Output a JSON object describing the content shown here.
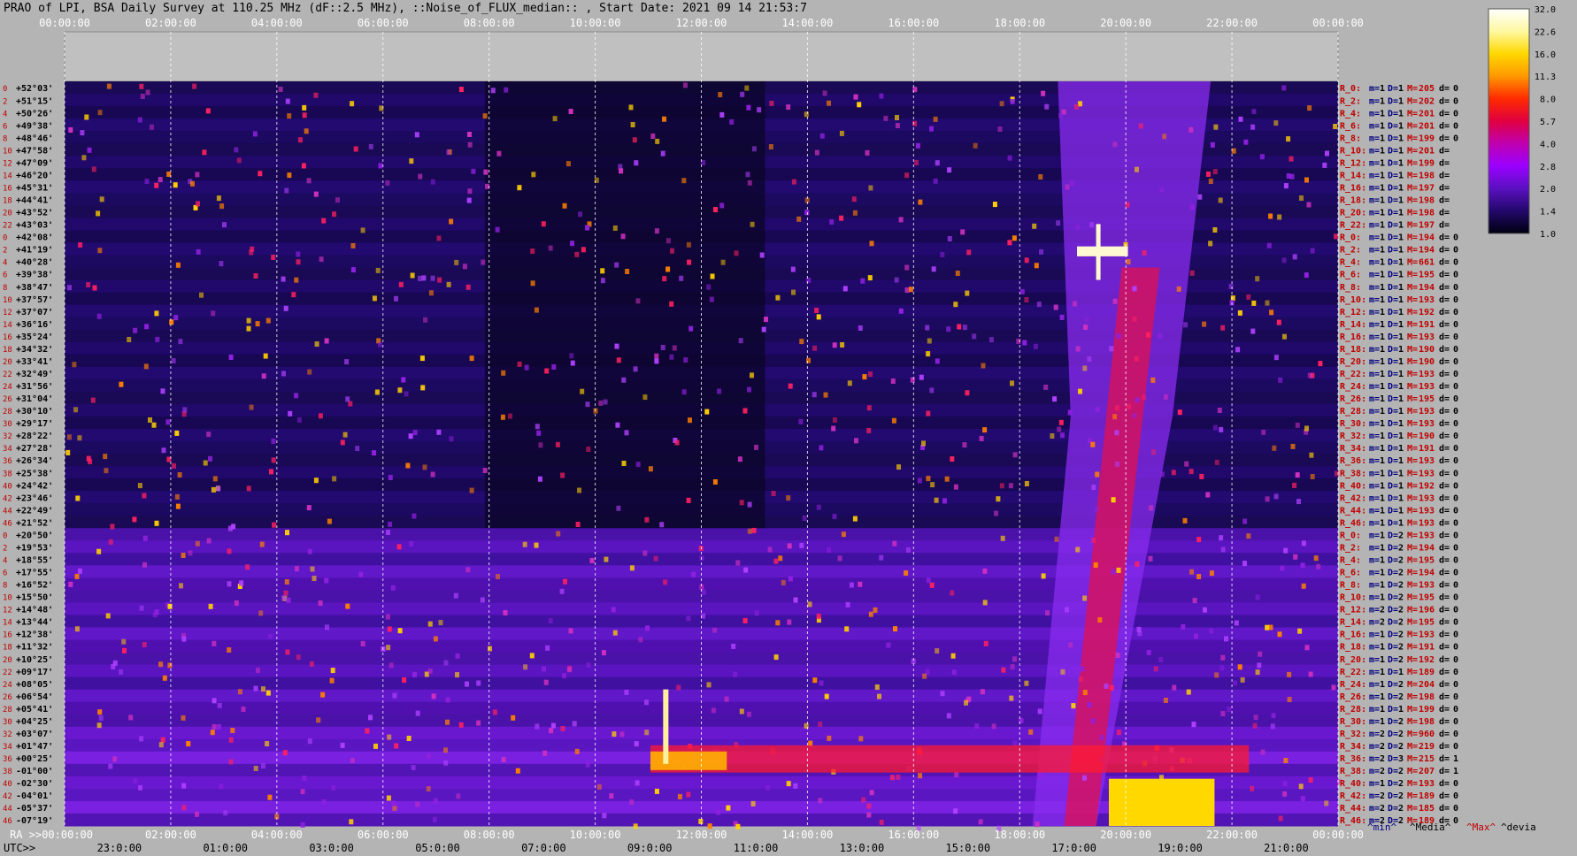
{
  "title": "PRAO of LPI, BSA Daily Survey at 110.25 MHz (dF::2.5 MHz), ::Noise_of_FLUX_median:: , Start Date: 2021 09 14 21:53:7",
  "chart_data": {
    "type": "heatmap",
    "title": "PRAO of LPI, BSA Daily Survey at 110.25 MHz (dF::2.5 MHz), ::Noise_of_FLUX_median:: , Start Date: 2021 09 14 21:53:7",
    "x_top_ticks": [
      "00:00:00",
      "02:00:00",
      "04:00:00",
      "06:00:00",
      "08:00:00",
      "10:00:00",
      "12:00:00",
      "14:00:00",
      "16:00:00",
      "18:00:00",
      "20:00:00",
      "22:00:00",
      "00:00:00"
    ],
    "x_ra_ticks": [
      "RA >>00:00:00",
      "02:00:00",
      "04:00:00",
      "06:00:00",
      "08:00:00",
      "10:00:00",
      "12:00:00",
      "14:00:00",
      "16:00:00",
      "18:00:00",
      "20:00:00",
      "22:00:00",
      "00:00:00"
    ],
    "x_utc_label": "UTC>>",
    "x_utc_ticks": [
      "23:0:00",
      "01:0:00",
      "03:0:00",
      "05:0:00",
      "07:0:00",
      "09:0:00",
      "11:0:00",
      "13:0:00",
      "15:0:00",
      "17:0:00",
      "19:0:00",
      "21:0:00"
    ],
    "dec_labels": [
      "+52°03'",
      "+51°15'",
      "+50°26'",
      "+49°38'",
      "+48°46'",
      "+47°58'",
      "+47°09'",
      "+46°20'",
      "+45°31'",
      "+44°41'",
      "+43°52'",
      "+43°03'",
      "+42°08'",
      "+41°19'",
      "+40°28'",
      "+39°38'",
      "+38°47'",
      "+37°57'",
      "+37°07'",
      "+36°16'",
      "+35°24'",
      "+34°32'",
      "+33°41'",
      "+32°49'",
      "+31°56'",
      "+31°04'",
      "+30°10'",
      "+29°17'",
      "+28°22'",
      "+27°28'",
      "+26°34'",
      "+25°38'",
      "+24°42'",
      "+23°46'",
      "+22°49'",
      "+21°52'",
      "+20°50'",
      "+19°53'",
      "+18°55'",
      "+17°55'",
      "+16°52'",
      "+15°50'",
      "+14°48'",
      "+13°44'",
      "+12°38'",
      "+11°32'",
      "+10°25'",
      "+09°17'",
      "+08°05'",
      "+06°54'",
      "+05°41'",
      "+04°25'",
      "+03°07'",
      "+01°47'",
      "+00°25'",
      "-01°00'",
      "-02°30'",
      "-04°01'",
      "-05°37'",
      "-07°19'"
    ],
    "dec_numbers": [
      "0",
      "2",
      "4",
      "6",
      "8",
      "10",
      "12",
      "14",
      "16",
      "18",
      "20",
      "22",
      "0",
      "2",
      "4",
      "6",
      "8",
      "10",
      "12",
      "14",
      "16",
      "18",
      "20",
      "22",
      "24",
      "26",
      "28",
      "30",
      "32",
      "34",
      "36",
      "38",
      "40",
      "42",
      "44",
      "46",
      "0",
      "2",
      "4",
      "6",
      "8",
      "10",
      "12",
      "14",
      "16",
      "18",
      "20",
      "22",
      "24",
      "26",
      "28",
      "30",
      "32",
      "34",
      "36",
      "38",
      "40",
      "42",
      "44",
      "46"
    ],
    "row_stats": [
      {
        "r": "R_0:",
        "m": "1",
        "D": "1",
        "M": "205",
        "d": "0"
      },
      {
        "r": "R_2:",
        "m": "1",
        "D": "1",
        "M": "202",
        "d": "0"
      },
      {
        "r": "R_4:",
        "m": "1",
        "D": "1",
        "M": "201",
        "d": "0"
      },
      {
        "r": "R_6:",
        "m": "1",
        "D": "1",
        "M": "201",
        "d": "0"
      },
      {
        "r": "R_8:",
        "m": "1",
        "D": "1",
        "M": "199",
        "d": "0"
      },
      {
        "r": "R_10:",
        "m": "1",
        "D": "1",
        "M": "201",
        "d": ""
      },
      {
        "r": "R_12:",
        "m": "1",
        "D": "1",
        "M": "199",
        "d": ""
      },
      {
        "r": "R_14:",
        "m": "1",
        "D": "1",
        "M": "198",
        "d": ""
      },
      {
        "r": "R_16:",
        "m": "1",
        "D": "1",
        "M": "197",
        "d": ""
      },
      {
        "r": "R_18:",
        "m": "1",
        "D": "1",
        "M": "198",
        "d": ""
      },
      {
        "r": "R_20:",
        "m": "1",
        "D": "1",
        "M": "198",
        "d": ""
      },
      {
        "r": "R_22:",
        "m": "1",
        "D": "1",
        "M": "197",
        "d": ""
      },
      {
        "r": "R_0:",
        "m": "1",
        "D": "1",
        "M": "194",
        "d": "0"
      },
      {
        "r": "R_2:",
        "m": "1",
        "D": "1",
        "M": "194",
        "d": "0"
      },
      {
        "r": "R_4:",
        "m": "1",
        "D": "1",
        "M": "661",
        "d": "0"
      },
      {
        "r": "R_6:",
        "m": "1",
        "D": "1",
        "M": "195",
        "d": "0"
      },
      {
        "r": "R_8:",
        "m": "1",
        "D": "1",
        "M": "194",
        "d": "0"
      },
      {
        "r": "R_10:",
        "m": "1",
        "D": "1",
        "M": "193",
        "d": "0"
      },
      {
        "r": "R_12:",
        "m": "1",
        "D": "1",
        "M": "192",
        "d": "0"
      },
      {
        "r": "R_14:",
        "m": "1",
        "D": "1",
        "M": "191",
        "d": "0"
      },
      {
        "r": "R_16:",
        "m": "1",
        "D": "1",
        "M": "193",
        "d": "0"
      },
      {
        "r": "R_18:",
        "m": "1",
        "D": "1",
        "M": "190",
        "d": "0"
      },
      {
        "r": "R_20:",
        "m": "1",
        "D": "1",
        "M": "190",
        "d": "0"
      },
      {
        "r": "R_22:",
        "m": "1",
        "D": "1",
        "M": "193",
        "d": "0"
      },
      {
        "r": "R_24:",
        "m": "1",
        "D": "1",
        "M": "193",
        "d": "0"
      },
      {
        "r": "R_26:",
        "m": "1",
        "D": "1",
        "M": "195",
        "d": "0"
      },
      {
        "r": "R_28:",
        "m": "1",
        "D": "1",
        "M": "193",
        "d": "0"
      },
      {
        "r": "R_30:",
        "m": "1",
        "D": "1",
        "M": "193",
        "d": "0"
      },
      {
        "r": "R_32:",
        "m": "1",
        "D": "1",
        "M": "190",
        "d": "0"
      },
      {
        "r": "R_34:",
        "m": "1",
        "D": "1",
        "M": "191",
        "d": "0"
      },
      {
        "r": "R_36:",
        "m": "1",
        "D": "1",
        "M": "193",
        "d": "0"
      },
      {
        "r": "R_38:",
        "m": "1",
        "D": "1",
        "M": "193",
        "d": "0"
      },
      {
        "r": "R_40:",
        "m": "1",
        "D": "1",
        "M": "192",
        "d": "0"
      },
      {
        "r": "R_42:",
        "m": "1",
        "D": "1",
        "M": "193",
        "d": "0"
      },
      {
        "r": "R_44:",
        "m": "1",
        "D": "1",
        "M": "193",
        "d": "0"
      },
      {
        "r": "R_46:",
        "m": "1",
        "D": "1",
        "M": "193",
        "d": "0"
      },
      {
        "r": "R_0:",
        "m": "1",
        "D": "2",
        "M": "193",
        "d": "0"
      },
      {
        "r": "R_2:",
        "m": "1",
        "D": "2",
        "M": "194",
        "d": "0"
      },
      {
        "r": "R_4:",
        "m": "1",
        "D": "2",
        "M": "195",
        "d": "0"
      },
      {
        "r": "R_6:",
        "m": "1",
        "D": "2",
        "M": "194",
        "d": "0"
      },
      {
        "r": "R_8:",
        "m": "1",
        "D": "2",
        "M": "193",
        "d": "0"
      },
      {
        "r": "R_10:",
        "m": "1",
        "D": "2",
        "M": "195",
        "d": "0"
      },
      {
        "r": "R_12:",
        "m": "2",
        "D": "2",
        "M": "196",
        "d": "0"
      },
      {
        "r": "R_14:",
        "m": "2",
        "D": "2",
        "M": "195",
        "d": "0"
      },
      {
        "r": "R_16:",
        "m": "1",
        "D": "2",
        "M": "193",
        "d": "0"
      },
      {
        "r": "R_18:",
        "m": "1",
        "D": "2",
        "M": "191",
        "d": "0"
      },
      {
        "r": "R_20:",
        "m": "1",
        "D": "2",
        "M": "192",
        "d": "0"
      },
      {
        "r": "R_22:",
        "m": "1",
        "D": "1",
        "M": "189",
        "d": "0"
      },
      {
        "r": "R_24:",
        "m": "1",
        "D": "2",
        "M": "204",
        "d": "0"
      },
      {
        "r": "R_26:",
        "m": "1",
        "D": "2",
        "M": "198",
        "d": "0"
      },
      {
        "r": "R_28:",
        "m": "1",
        "D": "1",
        "M": "199",
        "d": "0"
      },
      {
        "r": "R_30:",
        "m": "1",
        "D": "2",
        "M": "198",
        "d": "0"
      },
      {
        "r": "R_32:",
        "m": "2",
        "D": "2",
        "M": "960",
        "d": "0"
      },
      {
        "r": "R_34:",
        "m": "2",
        "D": "2",
        "M": "219",
        "d": "0"
      },
      {
        "r": "R_36:",
        "m": "2",
        "D": "3",
        "M": "215",
        "d": "1"
      },
      {
        "r": "R_38:",
        "m": "2",
        "D": "2",
        "M": "207",
        "d": "1"
      },
      {
        "r": "R_40:",
        "m": "1",
        "D": "2",
        "M": "193",
        "d": "0"
      },
      {
        "r": "R_42:",
        "m": "2",
        "D": "2",
        "M": "189",
        "d": "0"
      },
      {
        "r": "R_44:",
        "m": "2",
        "D": "2",
        "M": "185",
        "d": "0"
      },
      {
        "r": "R_46:",
        "m": "2",
        "D": "2",
        "M": "189",
        "d": "0"
      }
    ],
    "row_keys": {
      "m": "m=",
      "D": "D=",
      "M": "M=",
      "d": "d="
    },
    "colorbar": {
      "ticks": [
        "32.0",
        "22.6",
        "16.0",
        "11.3",
        "8.0",
        "5.7",
        "4.0",
        "2.8",
        "2.0",
        "1.4",
        "1.0"
      ],
      "colors": [
        "#ffffff",
        "#fff8a0",
        "#ffd800",
        "#ff9800",
        "#ff2a00",
        "#e00040",
        "#c000b0",
        "#9a00ff",
        "#5a10c0",
        "#22086a",
        "#000010"
      ]
    },
    "footer": {
      "min": "^min^",
      "media": "^Media^",
      "max": "^Max^",
      "devia": "^devia"
    },
    "grid": true
  }
}
